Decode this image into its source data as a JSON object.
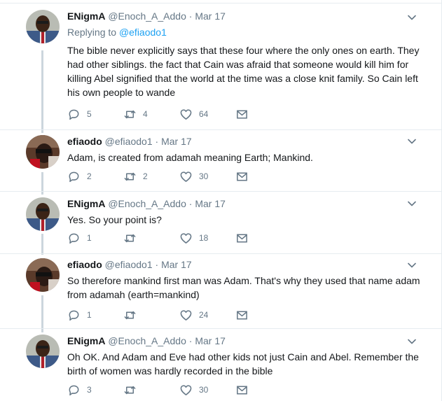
{
  "tweets": [
    {
      "name": "ENigmA",
      "handle": "@Enoch_A_Addo",
      "sep": "·",
      "date": "Mar 17",
      "replying_prefix": "Replying to ",
      "replying_to": "@efiaodo1",
      "text": "The bible never explicitly says that these four where the only ones on earth. They had other siblings. the fact that Cain was afraid that someone would kill him for killing Abel signified that the world at the time was a close knit family. So Cain left his own people to wande",
      "replies": "5",
      "retweets": "4",
      "likes": "64"
    },
    {
      "name": "efiaodo",
      "handle": "@efiaodo1",
      "sep": "·",
      "date": "Mar 17",
      "text": "Adam, is created from adamah meaning Earth; Mankind.",
      "replies": "2",
      "retweets": "2",
      "likes": "30"
    },
    {
      "name": "ENigmA",
      "handle": "@Enoch_A_Addo",
      "sep": "·",
      "date": "Mar 17",
      "text": "Yes.  So your point is?",
      "replies": "1",
      "retweets": "",
      "likes": "18"
    },
    {
      "name": "efiaodo",
      "handle": "@efiaodo1",
      "sep": "·",
      "date": "Mar 17",
      "text": "So therefore mankind first man was Adam. That's why they used that name adam from adamah (earth=mankind)",
      "replies": "1",
      "retweets": "",
      "likes": "24"
    },
    {
      "name": "ENigmA",
      "handle": "@Enoch_A_Addo",
      "sep": "·",
      "date": "Mar 17",
      "text": "Oh OK. And Adam and Eve had other kids not just Cain and Abel. Remember the birth of women was hardly recorded in the bible",
      "replies": "3",
      "retweets": "",
      "likes": "30"
    }
  ],
  "icons": {
    "reply": "reply-icon",
    "retweet": "retweet-icon",
    "like": "heart-icon",
    "dm": "envelope-icon",
    "more": "chevron-down-icon"
  },
  "colors": {
    "icon": "#657786",
    "link": "#1da1f2",
    "thread_line": "#ccd6dd",
    "divider": "#e6ecf0"
  }
}
